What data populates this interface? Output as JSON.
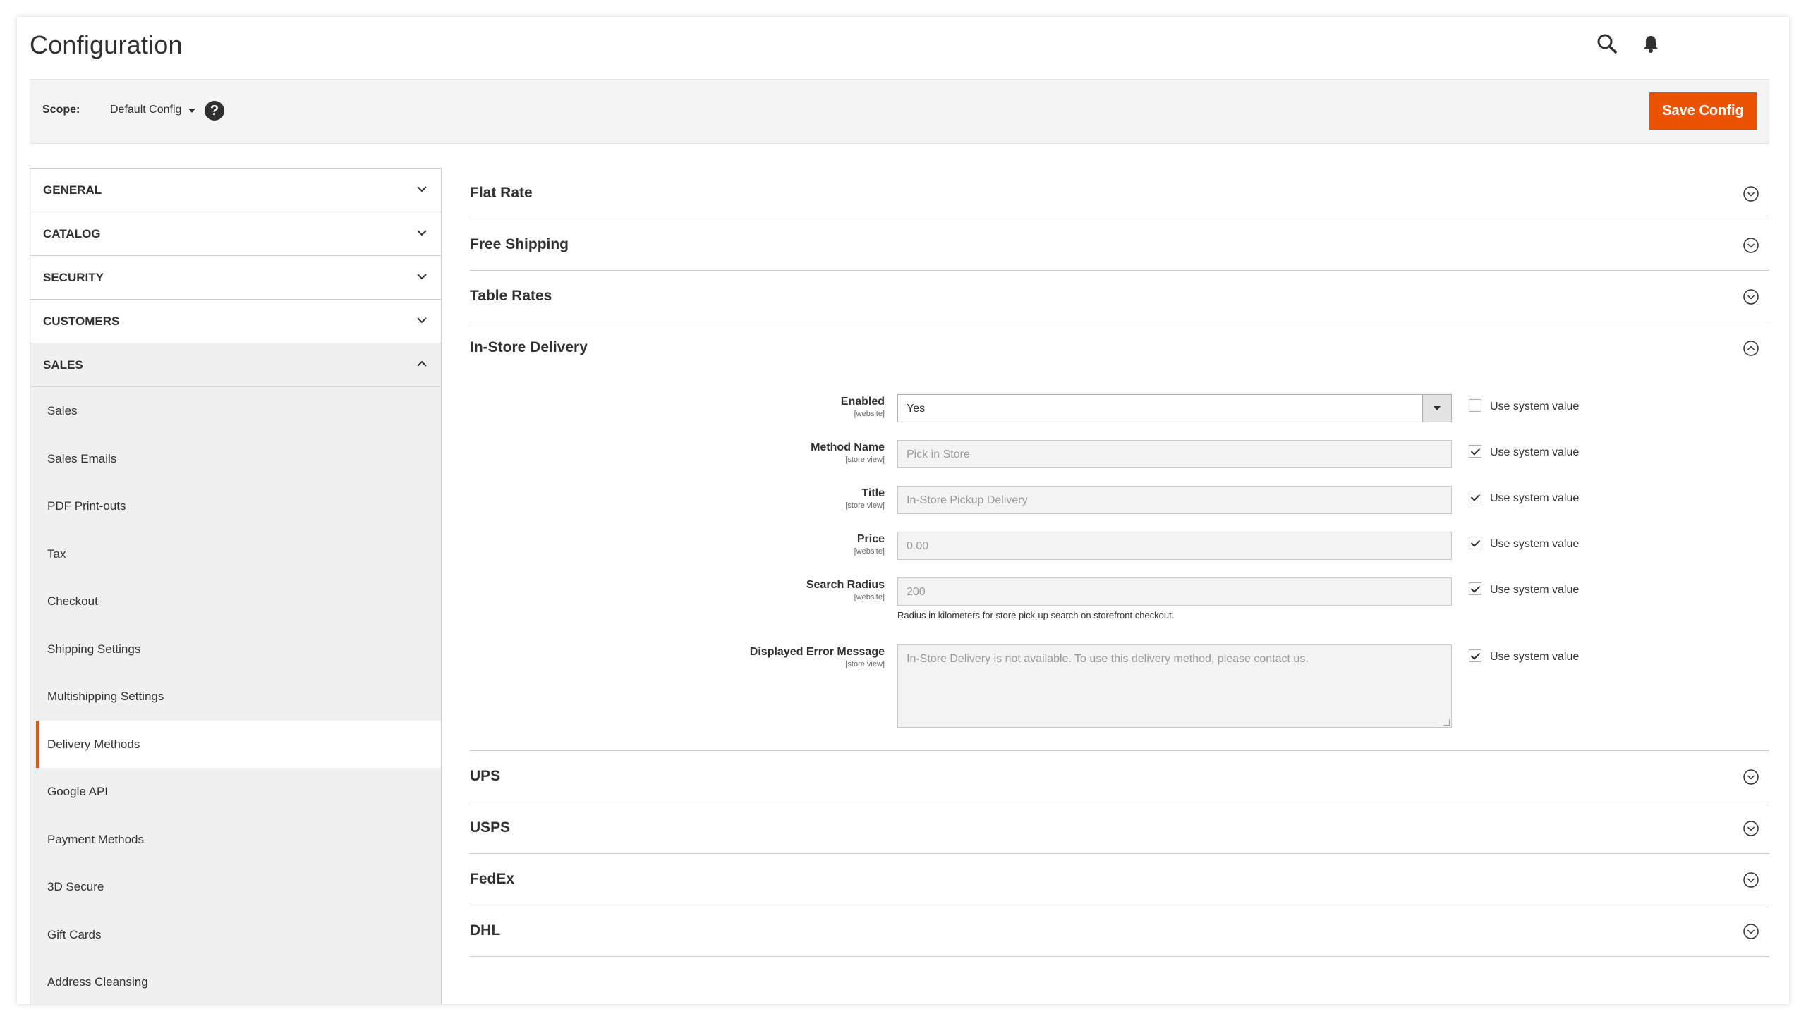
{
  "page": {
    "title": "Configuration"
  },
  "scope": {
    "label": "Scope:",
    "value": "Default Config",
    "save_label": "Save Config",
    "help": "?"
  },
  "sidebar": {
    "sections": [
      {
        "label": "GENERAL",
        "open": false
      },
      {
        "label": "CATALOG",
        "open": false
      },
      {
        "label": "SECURITY",
        "open": false
      },
      {
        "label": "CUSTOMERS",
        "open": false
      },
      {
        "label": "SALES",
        "open": true
      }
    ],
    "items": [
      {
        "label": "Sales"
      },
      {
        "label": "Sales Emails"
      },
      {
        "label": "PDF Print-outs"
      },
      {
        "label": "Tax"
      },
      {
        "label": "Checkout"
      },
      {
        "label": "Shipping Settings"
      },
      {
        "label": "Multishipping Settings"
      },
      {
        "label": "Delivery Methods",
        "active": true
      },
      {
        "label": "Google API"
      },
      {
        "label": "Payment Methods"
      },
      {
        "label": "3D Secure"
      },
      {
        "label": "Gift Cards"
      },
      {
        "label": "Address Cleansing"
      }
    ]
  },
  "sections_before": [
    {
      "title": "Flat Rate"
    },
    {
      "title": "Free Shipping"
    },
    {
      "title": "Table Rates"
    }
  ],
  "open_section": {
    "title": "In-Store Delivery",
    "fields": [
      {
        "label": "Enabled",
        "scope": "[website]",
        "value": "Yes",
        "use_system": false,
        "use_system_label": "Use system value"
      },
      {
        "label": "Method Name",
        "scope": "[store view]",
        "value": "Pick in Store",
        "use_system": true,
        "use_system_label": "Use system value"
      },
      {
        "label": "Title",
        "scope": "[store view]",
        "value": "In-Store Pickup Delivery",
        "use_system": true,
        "use_system_label": "Use system value"
      },
      {
        "label": "Price",
        "scope": "[website]",
        "value": "0.00",
        "use_system": true,
        "use_system_label": "Use system value"
      },
      {
        "label": "Search Radius",
        "scope": "[website]",
        "value": "200",
        "use_system": true,
        "use_system_label": "Use system value",
        "note": "Radius in kilometers for store pick-up search on storefront checkout."
      },
      {
        "label": "Displayed Error Message",
        "scope": "[store view]",
        "value": "In-Store Delivery is not available. To use this delivery method, please contact us.",
        "use_system": true,
        "use_system_label": "Use system value"
      }
    ]
  },
  "sections_after": [
    {
      "title": "UPS"
    },
    {
      "title": "USPS"
    },
    {
      "title": "FedEx"
    },
    {
      "title": "DHL"
    }
  ],
  "colors": {
    "accent": "#eb5202",
    "text": "#303030",
    "border": "#cccccc"
  }
}
